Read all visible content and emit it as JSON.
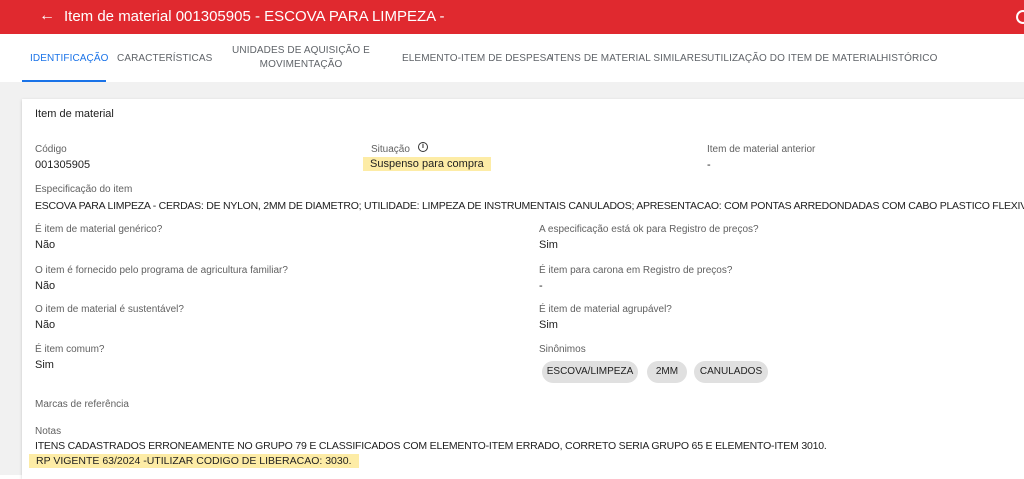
{
  "header": {
    "back_icon": "arrow-left-icon",
    "title": "Item de material 001305905 - ESCOVA PARA LIMPEZA -",
    "color": "#e0292f"
  },
  "tabs": [
    {
      "label": "IDENTIFICAÇÃO",
      "active": true
    },
    {
      "label": "CARACTERÍSTICAS"
    },
    {
      "label_line1": "UNIDADES DE AQUISIÇÃO E",
      "label_line2": "MOVIMENTAÇÃO"
    },
    {
      "label": "ELEMENTO-ITEM DE DESPESA"
    },
    {
      "label": "ITENS DE MATERIAL SIMILARES"
    },
    {
      "label": "UTILIZAÇÃO DO ITEM DE MATERIAL"
    },
    {
      "label": "HISTÓRICO"
    }
  ],
  "card": {
    "title": "Item de material",
    "codigo": {
      "label": "Código",
      "value": "001305905"
    },
    "situacao": {
      "label": "Situação",
      "value": "Suspenso para compra"
    },
    "anterior": {
      "label": "Item de material anterior",
      "value": "-"
    },
    "especificacao": {
      "label": "Especificação do item",
      "value": "ESCOVA PARA LIMPEZA - CERDAS: DE NYLON, 2MM DE DIAMETRO; UTILIDADE: LIMPEZA DE INSTRUMENTAIS CANULADOS; APRESENTACAO: COM PONTAS ARREDONDADAS COM CABO PLASTICO FLEXIVEL;"
    },
    "left_fields": [
      {
        "label": "É item de material genérico?",
        "value": "Não"
      },
      {
        "label": "O item é fornecido pelo programa de agricultura familiar?",
        "value": "Não"
      },
      {
        "label": "O item de material é sustentável?",
        "value": "Não"
      },
      {
        "label": "É item comum?",
        "value": "Sim"
      }
    ],
    "right_fields": [
      {
        "label": "A especificação está ok para Registro de preços?",
        "value": "Sim"
      },
      {
        "label": "É item para carona em Registro de preços?",
        "value": "-"
      },
      {
        "label": "É item de material agrupável?",
        "value": "Sim"
      }
    ],
    "sinonimos": {
      "label": "Sinônimos",
      "chips": [
        "ESCOVA/LIMPEZA",
        "2MM",
        "CANULADOS"
      ]
    },
    "marcas": {
      "label": "Marcas de referência"
    },
    "notas": {
      "label": "Notas",
      "line1": "ITENS CADASTRADOS ERRONEAMENTE NO GRUPO 79 E CLASSIFICADOS COM ELEMENTO-ITEM ERRADO, CORRETO SERIA GRUPO 65 E ELEMENTO-ITEM 3010.",
      "line2": "RP VIGENTE 63/2024 -UTILIZAR CODIGO DE LIBERACAO: 3030."
    },
    "highlight_color": "#fdeca6"
  }
}
